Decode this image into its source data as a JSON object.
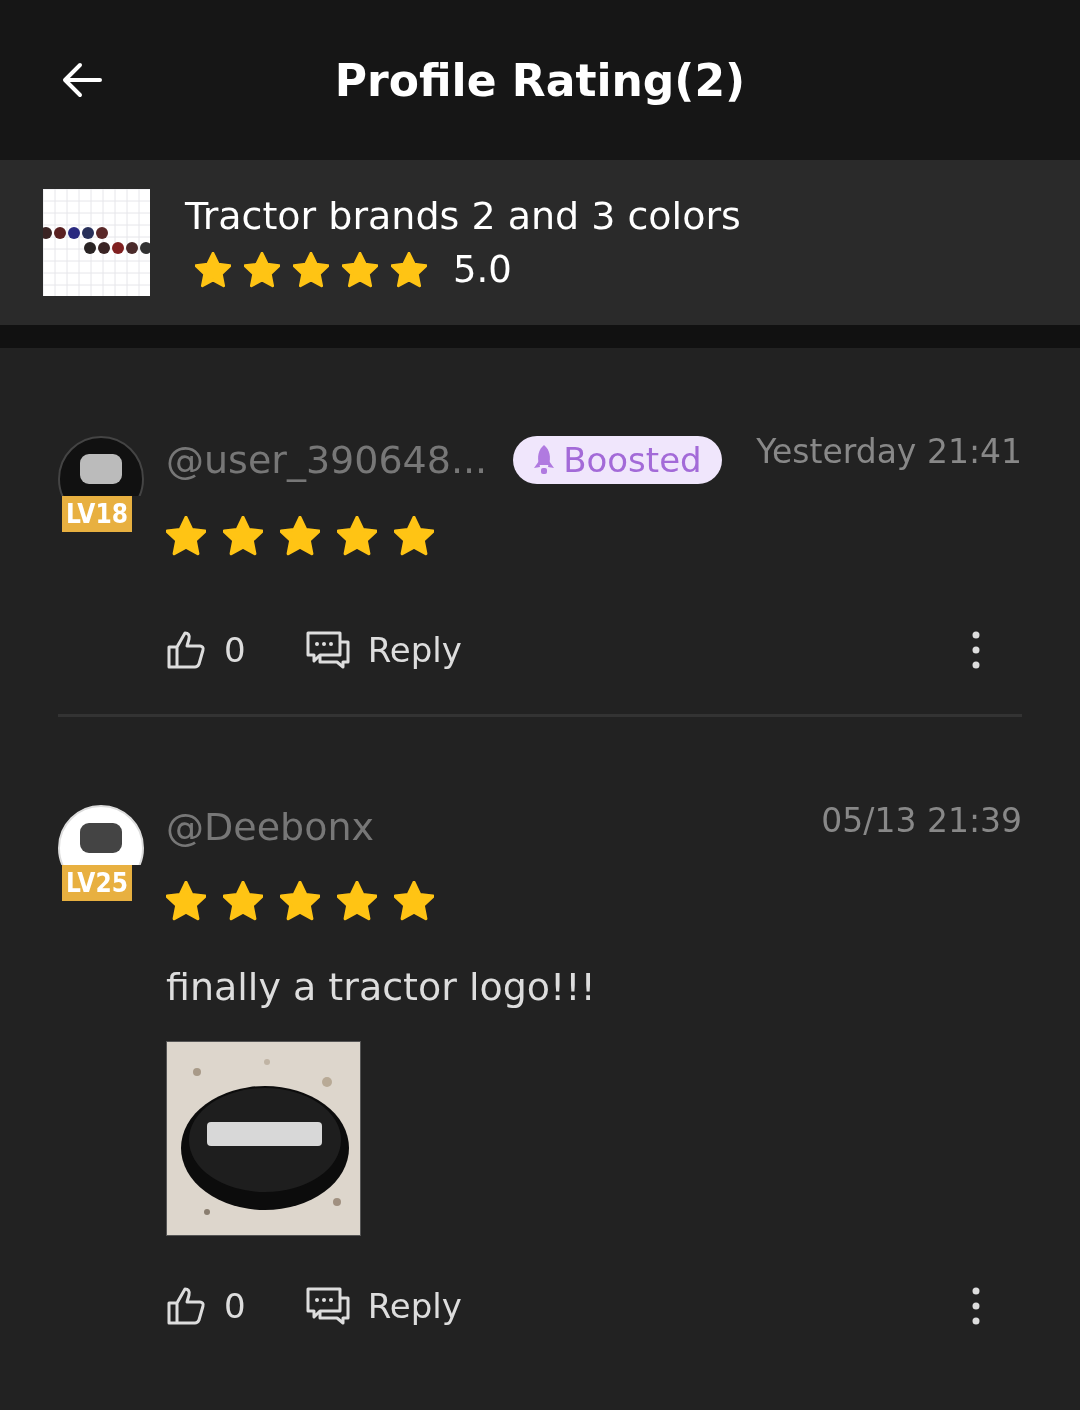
{
  "header": {
    "title": "Profile Rating(2)"
  },
  "model": {
    "title": "Tractor brands 2 and 3 colors",
    "stars": 5,
    "score": "5.0"
  },
  "reviews": [
    {
      "user": "@user_390648...",
      "level": "LV18",
      "badge": "Boosted",
      "time": "Yesterday 21:41",
      "stars": 5,
      "likes": "0",
      "reply": "Reply"
    },
    {
      "user": "@Deebonx",
      "level": "LV25",
      "time": "05/13 21:39",
      "stars": 5,
      "text": "finally a tractor logo!!!",
      "likes": "0",
      "reply": "Reply"
    }
  ]
}
